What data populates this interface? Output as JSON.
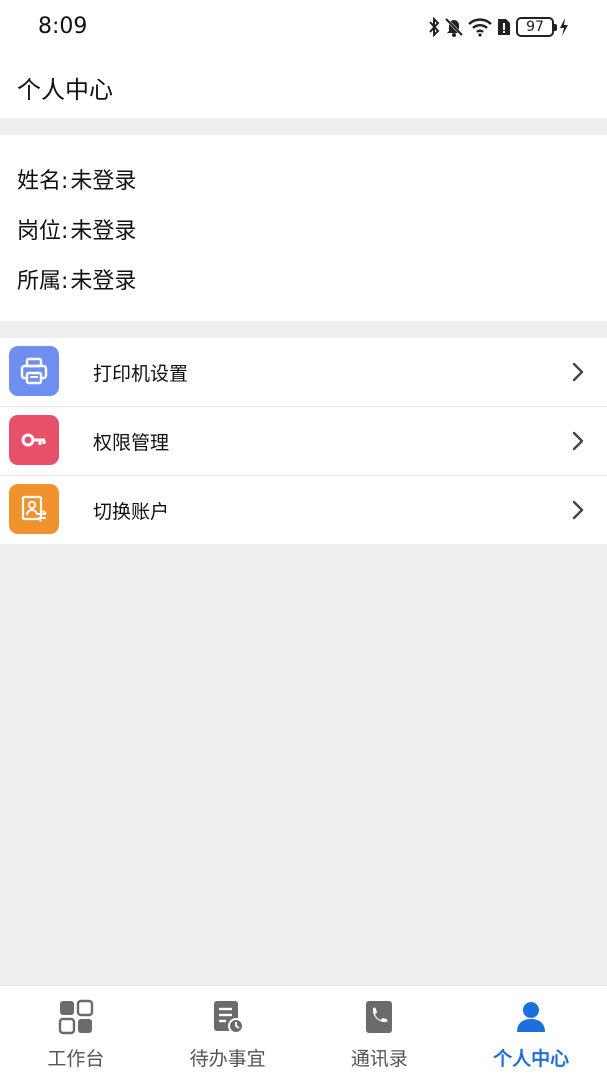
{
  "status_bar": {
    "time": "8:09",
    "battery": "97",
    "icons": [
      "bluetooth-icon",
      "bell-muted-icon",
      "wifi-icon",
      "sim-alert-icon",
      "battery-icon",
      "charging-icon"
    ]
  },
  "header": {
    "title": "个人中心"
  },
  "profile": {
    "name_label": "姓名:",
    "name_value": "未登录",
    "post_label": "岗位:",
    "post_value": "未登录",
    "dept_label": "所属:",
    "dept_value": "未登录"
  },
  "menu": {
    "items": [
      {
        "label": "打印机设置",
        "icon": "printer-icon",
        "color": "#6f8ff0"
      },
      {
        "label": "权限管理",
        "icon": "key-icon",
        "color": "#e8506a"
      },
      {
        "label": "切换账户",
        "icon": "switch-account-icon",
        "color": "#f0932e"
      }
    ]
  },
  "tabs": [
    {
      "label": "工作台",
      "icon": "grid-icon",
      "active": false
    },
    {
      "label": "待办事宜",
      "icon": "todo-icon",
      "active": false
    },
    {
      "label": "通讯录",
      "icon": "phone-book-icon",
      "active": false
    },
    {
      "label": "个人中心",
      "icon": "person-icon",
      "active": true
    }
  ],
  "colors": {
    "accent": "#1d6fd9",
    "background": "#efefef",
    "tab_inactive": "#555555"
  }
}
